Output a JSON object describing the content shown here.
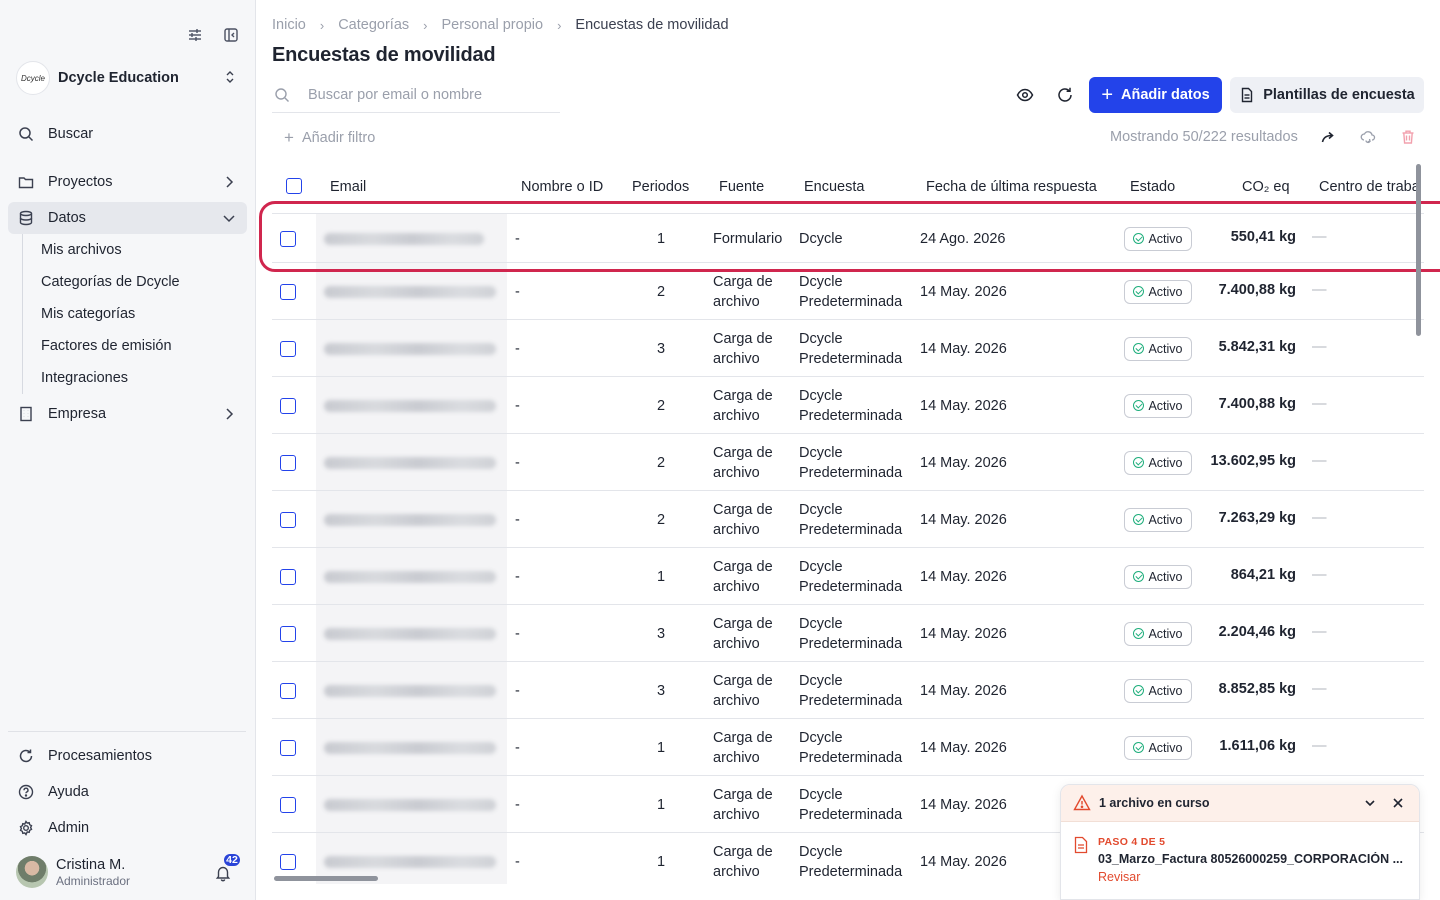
{
  "sidebar": {
    "org_logo_text": "Dcycle",
    "org_name": "Dcycle Education",
    "search_label": "Buscar",
    "items": {
      "proyectos": "Proyectos",
      "datos": "Datos",
      "empresa": "Empresa"
    },
    "sub_items": [
      "Mis archivos",
      "Categorías de Dcycle",
      "Mis categorías",
      "Factores de emisión",
      "Integraciones"
    ],
    "bottom": {
      "procesamientos": "Procesamientos",
      "ayuda": "Ayuda",
      "admin": "Admin"
    },
    "user": {
      "name": "Cristina M.",
      "role": "Administrador",
      "notifications": "42"
    }
  },
  "breadcrumb": [
    "Inicio",
    "Categorías",
    "Personal propio",
    "Encuestas de movilidad"
  ],
  "page_title": "Encuestas de movilidad",
  "search": {
    "placeholder": "Buscar por email o nombre"
  },
  "buttons": {
    "add_data": "Añadir datos",
    "templates": "Plantillas de encuesta",
    "add_filter": "Añadir filtro"
  },
  "results_text": "Mostrando 50/222 resultados",
  "table": {
    "headers": {
      "email": "Email",
      "name": "Nombre o ID",
      "periods": "Periodos",
      "source": "Fuente",
      "survey": "Encuesta",
      "last_response": "Fecha de última respuesta",
      "status": "Estado",
      "co2": "CO₂ eq",
      "center": "Centro de traba"
    },
    "rows": [
      {
        "name": "-",
        "periods": "1",
        "source": "Formulario",
        "survey": "Dcycle",
        "date": "24 Ago. 2026",
        "status": "Activo",
        "co2": "550,41 kg",
        "center": "—"
      },
      {
        "name": "-",
        "periods": "2",
        "source": "Carga de archivo",
        "survey": "Dcycle Predeterminada",
        "date": "14 May. 2026",
        "status": "Activo",
        "co2": "7.400,88 kg",
        "center": "—"
      },
      {
        "name": "-",
        "periods": "3",
        "source": "Carga de archivo",
        "survey": "Dcycle Predeterminada",
        "date": "14 May. 2026",
        "status": "Activo",
        "co2": "5.842,31 kg",
        "center": "—"
      },
      {
        "name": "-",
        "periods": "2",
        "source": "Carga de archivo",
        "survey": "Dcycle Predeterminada",
        "date": "14 May. 2026",
        "status": "Activo",
        "co2": "7.400,88 kg",
        "center": "—"
      },
      {
        "name": "-",
        "periods": "2",
        "source": "Carga de archivo",
        "survey": "Dcycle Predeterminada",
        "date": "14 May. 2026",
        "status": "Activo",
        "co2": "13.602,95 kg",
        "center": "—"
      },
      {
        "name": "-",
        "periods": "2",
        "source": "Carga de archivo",
        "survey": "Dcycle Predeterminada",
        "date": "14 May. 2026",
        "status": "Activo",
        "co2": "7.263,29 kg",
        "center": "—"
      },
      {
        "name": "-",
        "periods": "1",
        "source": "Carga de archivo",
        "survey": "Dcycle Predeterminada",
        "date": "14 May. 2026",
        "status": "Activo",
        "co2": "864,21 kg",
        "center": "—"
      },
      {
        "name": "-",
        "periods": "3",
        "source": "Carga de archivo",
        "survey": "Dcycle Predeterminada",
        "date": "14 May. 2026",
        "status": "Activo",
        "co2": "2.204,46 kg",
        "center": "—"
      },
      {
        "name": "-",
        "periods": "3",
        "source": "Carga de archivo",
        "survey": "Dcycle Predeterminada",
        "date": "14 May. 2026",
        "status": "Activo",
        "co2": "8.852,85 kg",
        "center": "—"
      },
      {
        "name": "-",
        "periods": "1",
        "source": "Carga de archivo",
        "survey": "Dcycle Predeterminada",
        "date": "14 May. 2026",
        "status": "Activo",
        "co2": "1.611,06 kg",
        "center": "—"
      },
      {
        "name": "-",
        "periods": "1",
        "source": "Carga de archivo",
        "survey": "Dcycle Predeterminada",
        "date": "14 May. 2026",
        "status": "",
        "co2": "",
        "center": ""
      },
      {
        "name": "-",
        "periods": "1",
        "source": "Carga de archivo",
        "survey": "Dcycle Predeterminada",
        "date": "14 May. 2026",
        "status": "",
        "co2": "",
        "center": ""
      }
    ]
  },
  "upload": {
    "title": "1 archivo en curso",
    "step": "PASO 4 DE 5",
    "file": "03_Marzo_Factura 80526000259_CORPORACIÓN ...",
    "action": "Revisar"
  },
  "colors": {
    "primary": "#2343ea",
    "highlight": "#d0264e",
    "status_ok": "#1fae7c",
    "warning": "#e24a2e"
  }
}
